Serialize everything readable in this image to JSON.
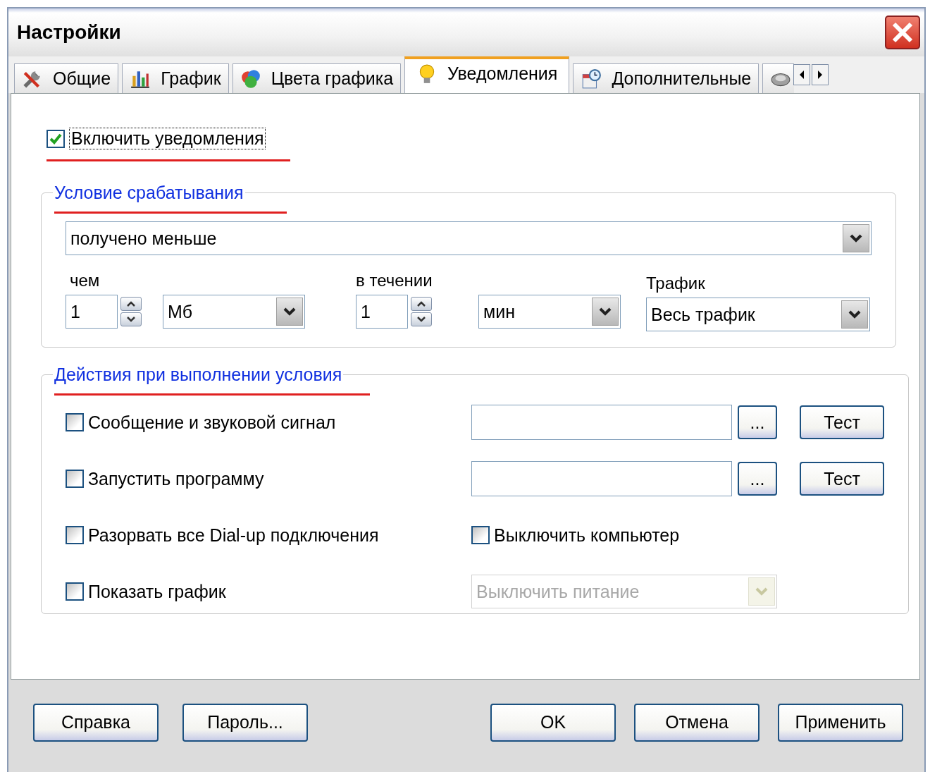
{
  "window": {
    "title": "Настройки"
  },
  "tabs": [
    {
      "label": "Общие",
      "selected": false
    },
    {
      "label": "График",
      "selected": false
    },
    {
      "label": "Цвета графика",
      "selected": false
    },
    {
      "label": "Уведомления",
      "selected": true
    },
    {
      "label": "Дополнительные",
      "selected": false
    },
    {
      "selected": false
    }
  ],
  "enable": {
    "label": "Включить уведомления",
    "checked": true
  },
  "condition": {
    "title": "Условие срабатывания",
    "mode": "получено меньше",
    "amount": {
      "label": "чем",
      "value": "1",
      "unit": "Мб"
    },
    "period": {
      "label": "в течении",
      "value": "1",
      "unit": "мин"
    },
    "traffic": {
      "label": "Трафик",
      "value": "Весь трафик"
    }
  },
  "actions": {
    "title": "Действия при выполнении условия",
    "rows": [
      {
        "kind": "file",
        "label": "Сообщение и звуковой сигнал",
        "checked": false,
        "browse": "...",
        "test": "Тест"
      },
      {
        "kind": "file",
        "label": "Запустить программу",
        "checked": false,
        "browse": "...",
        "test": "Тест"
      },
      {
        "kind": "toggle",
        "label": "Разорвать все Dial-up подключения",
        "checked": false,
        "extra": {
          "label": "Выключить компьютер",
          "checked": false
        }
      },
      {
        "kind": "dropdown",
        "label": "Показать график",
        "checked": false,
        "extra": {
          "value": "Выключить питание",
          "disabled": true
        }
      }
    ]
  },
  "buttons_left": [
    "Справка",
    "Пароль..."
  ],
  "buttons_right": [
    "OK",
    "Отмена",
    "Применить"
  ]
}
